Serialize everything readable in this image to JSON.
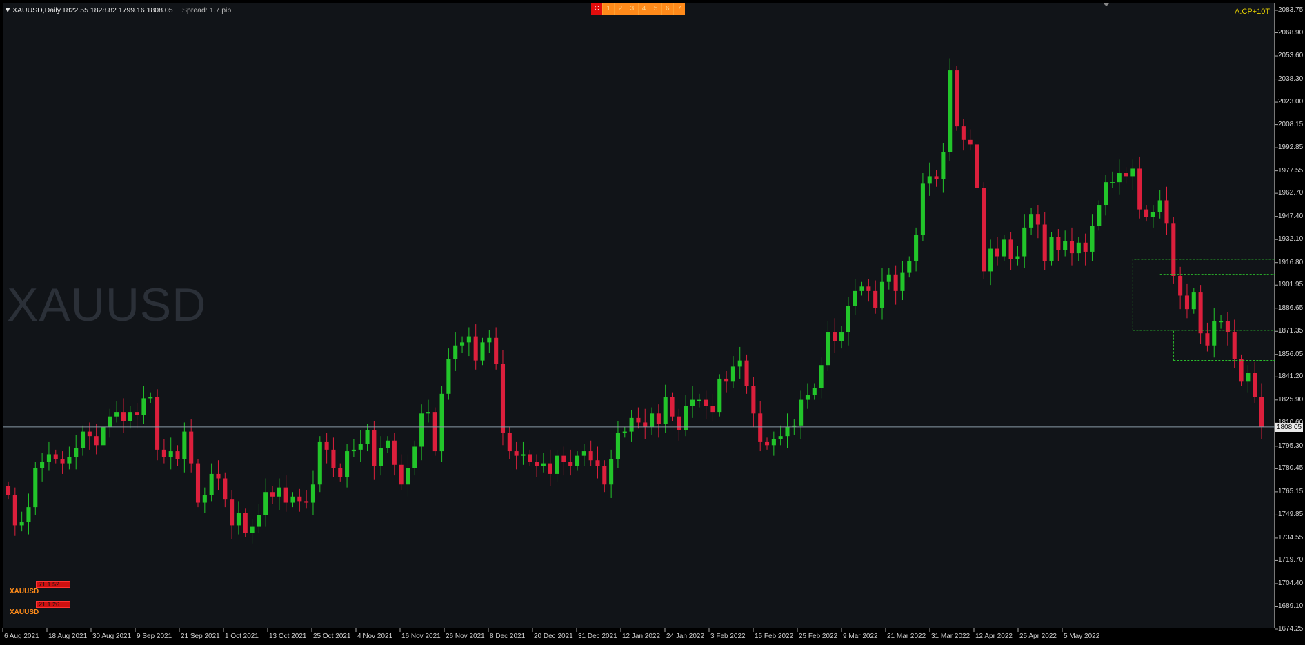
{
  "header": {
    "symbol_timeframe": "XAUUSD,Daily",
    "ohlc": "1822.55 1828.82 1799.16 1808.05",
    "spread": "Spread: 1.7 pip",
    "mode_label": "A:CP+10T"
  },
  "watermark": "XAUUSD",
  "current_price": "1808.05",
  "timeframe_buttons": [
    "C",
    "1",
    "2",
    "3",
    "4",
    "5",
    "6",
    "7"
  ],
  "signal_panels": [
    {
      "box_text": "71  1.52",
      "symbol": "XAUUSD"
    },
    {
      "box_text": "21  1.26",
      "symbol": "XAUUSD"
    }
  ],
  "colors": {
    "background": "#111418",
    "bull": "#22c52a",
    "bear": "#dc1f3c",
    "grid_dashed": "#2fd12f",
    "price_line": "#8a9aa6"
  },
  "chart_data": {
    "type": "candlestick",
    "title": "XAUUSD,Daily",
    "ylim": [
      1674.25,
      2083.75
    ],
    "y_ticks": [
      "2083.75",
      "2068.90",
      "2053.60",
      "2038.30",
      "2023.00",
      "2008.15",
      "1992.85",
      "1977.55",
      "1962.70",
      "1947.40",
      "1932.10",
      "1916.80",
      "1901.95",
      "1886.65",
      "1871.35",
      "1856.05",
      "1841.20",
      "1825.90",
      "1810.60",
      "1795.30",
      "1780.45",
      "1765.15",
      "1749.85",
      "1734.55",
      "1719.70",
      "1704.40",
      "1689.10",
      "1674.25"
    ],
    "x_ticks": [
      "6 Aug 2021",
      "18 Aug 2021",
      "30 Aug 2021",
      "9 Sep 2021",
      "21 Sep 2021",
      "1 Oct 2021",
      "13 Oct 2021",
      "25 Oct 2021",
      "4 Nov 2021",
      "16 Nov 2021",
      "26 Nov 2021",
      "8 Dec 2021",
      "20 Dec 2021",
      "31 Dec 2021",
      "12 Jan 2022",
      "24 Jan 2022",
      "3 Feb 2022",
      "15 Feb 2022",
      "25 Feb 2022",
      "9 Mar 2022",
      "21 Mar 2022",
      "31 Mar 2022",
      "12 Apr 2022",
      "25 Apr 2022",
      "5 May 2022"
    ],
    "last_close": 1808.05,
    "closes": [
      1763,
      1743,
      1745,
      1755,
      1781,
      1785,
      1790,
      1787,
      1784,
      1788,
      1794,
      1805,
      1802,
      1796,
      1808,
      1815,
      1818,
      1812,
      1818,
      1816,
      1827,
      1828,
      1793,
      1788,
      1792,
      1787,
      1805,
      1784,
      1758,
      1763,
      1777,
      1774,
      1760,
      1743,
      1751,
      1738,
      1742,
      1750,
      1765,
      1762,
      1768,
      1758,
      1762,
      1759,
      1758,
      1770,
      1798,
      1793,
      1781,
      1775,
      1792,
      1793,
      1797,
      1806,
      1782,
      1794,
      1799,
      1783,
      1770,
      1781,
      1795,
      1817,
      1818,
      1792,
      1830,
      1853,
      1862,
      1864,
      1868,
      1852,
      1864,
      1867,
      1850,
      1804,
      1792,
      1789,
      1790,
      1785,
      1782,
      1784,
      1777,
      1789,
      1785,
      1782,
      1789,
      1792,
      1786,
      1782,
      1770,
      1787,
      1804,
      1805,
      1814,
      1811,
      1808,
      1817,
      1810,
      1828,
      1815,
      1806,
      1822,
      1826,
      1826,
      1822,
      1818,
      1840,
      1838,
      1848,
      1852,
      1835,
      1817,
      1798,
      1796,
      1800,
      1802,
      1808,
      1809,
      1826,
      1829,
      1834,
      1849,
      1871,
      1865,
      1871,
      1888,
      1898,
      1901,
      1898,
      1887,
      1904,
      1909,
      1898,
      1910,
      1918,
      1935,
      1969,
      1974,
      1972,
      1990,
      2044,
      2007,
      1998,
      1995,
      1966,
      1911,
      1926,
      1921,
      1932,
      1919,
      1921,
      1940,
      1949,
      1942,
      1918,
      1934,
      1925,
      1931,
      1923,
      1930,
      1924,
      1941,
      1955,
      1970,
      1970,
      1976,
      1974,
      1979,
      1952,
      1947,
      1950,
      1958,
      1943,
      1908,
      1895,
      1886,
      1897,
      1870,
      1862,
      1878,
      1878,
      1871,
      1853,
      1838,
      1844,
      1828,
      1808
    ]
  }
}
